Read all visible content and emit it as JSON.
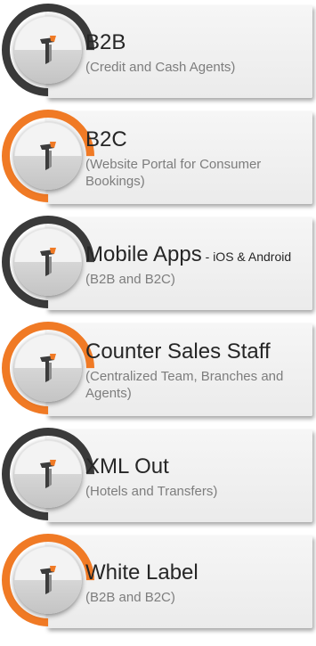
{
  "items": [
    {
      "title": "B2B",
      "title_suffix": "",
      "subtitle": "(Credit and Cash Agents)",
      "ring_color": "#3a3a3a",
      "icon": "brand-logo-icon"
    },
    {
      "title": "B2C",
      "title_suffix": "",
      "subtitle": "(Website Portal for Consumer Bookings)",
      "ring_color": "#f07a25",
      "icon": "brand-logo-icon"
    },
    {
      "title": "Mobile Apps",
      "title_suffix": " - iOS & Android",
      "subtitle": "(B2B and B2C)",
      "ring_color": "#3a3a3a",
      "icon": "brand-logo-icon"
    },
    {
      "title": "Counter Sales Staff",
      "title_suffix": "",
      "subtitle": "(Centralized Team, Branches and Agents)",
      "ring_color": "#f07a25",
      "icon": "brand-logo-icon"
    },
    {
      "title": "XML Out",
      "title_suffix": "",
      "subtitle": "(Hotels and Transfers)",
      "ring_color": "#3a3a3a",
      "icon": "brand-logo-icon"
    },
    {
      "title": "White Label",
      "title_suffix": "",
      "subtitle": "(B2B and B2C)",
      "ring_color": "#f07a25",
      "icon": "brand-logo-icon"
    }
  ],
  "colors": {
    "accent_orange": "#f07a25",
    "accent_dark": "#3a3a3a",
    "card_background": "#f0f0f0",
    "title_text": "#262626",
    "subtitle_text": "#7d7d7d"
  }
}
